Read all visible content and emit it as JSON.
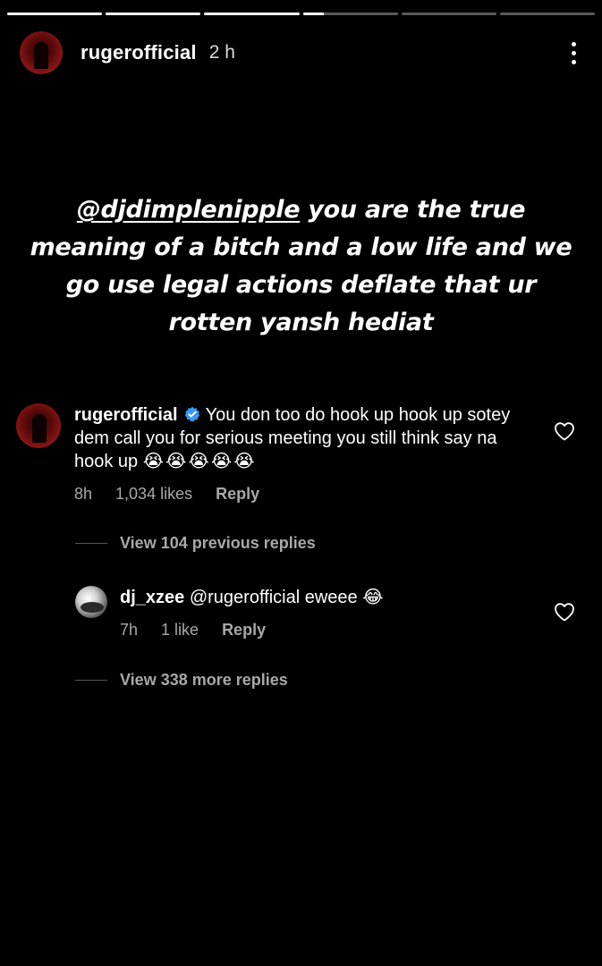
{
  "story": {
    "progress_segments": [
      1,
      1,
      1,
      0.22,
      0,
      0
    ],
    "username": "rugerofficial",
    "time": "2 h"
  },
  "caption": {
    "mention": "@djdimplenipple",
    "text": " you are the true meaning of a bitch and a low life and we go use legal actions deflate that ur rotten yansh hediat"
  },
  "comment": {
    "username": "rugerofficial",
    "text": "You don too do hook up hook up sotey dem call you for serious meeting you still think say na hook up",
    "emojis": "😭😭😭😭😭",
    "time": "8h",
    "likes": "1,034 likes",
    "reply_label": "Reply"
  },
  "view_previous": "View 104 previous replies",
  "reply": {
    "username": "dj_xzee",
    "text": "@rugerofficial eweee",
    "emoji": "😂",
    "time": "7h",
    "likes": "1 like",
    "reply_label": "Reply"
  },
  "view_more": "View 338 more replies",
  "colors": {
    "background": "#000000",
    "secondary_text": "#a8a8a8",
    "verified": "#3897f0"
  }
}
